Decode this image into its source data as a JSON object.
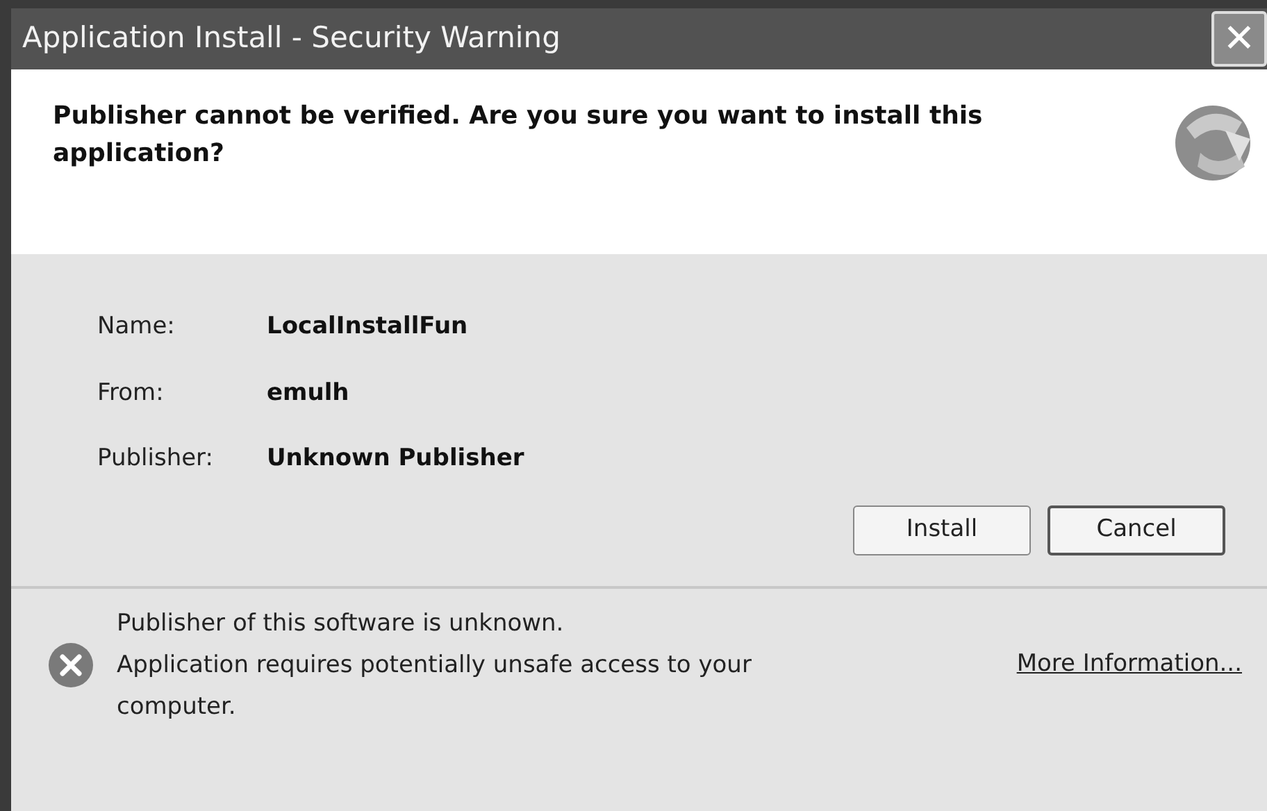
{
  "window": {
    "title": "Application Install - Security Warning",
    "close": "✕"
  },
  "header": {
    "question": "Publisher cannot be verified. Are you sure you want to install this application?"
  },
  "details": [
    {
      "label": "Name:",
      "value": "LocalInstallFun"
    },
    {
      "label": "From:",
      "value": "emulh"
    },
    {
      "label": "Publisher:",
      "value": "Unknown Publisher"
    }
  ],
  "buttons": [
    {
      "label": "Install",
      "default": false
    },
    {
      "label": "Cancel",
      "default": true
    }
  ],
  "footer": {
    "lines": [
      "Publisher of this software is unknown.",
      "Application requires potentially unsafe access to your computer."
    ],
    "link": "More Information..."
  }
}
